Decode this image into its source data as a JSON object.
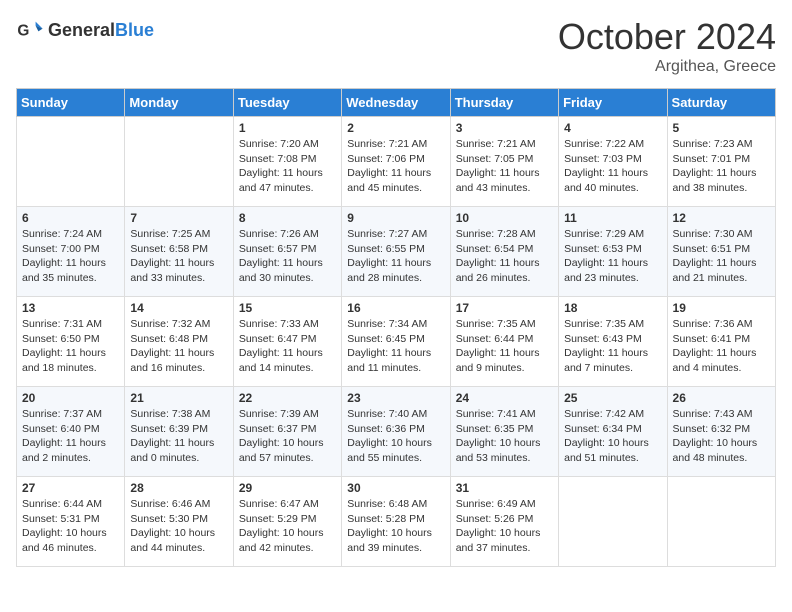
{
  "header": {
    "logo_general": "General",
    "logo_blue": "Blue",
    "month": "October 2024",
    "location": "Argithea, Greece"
  },
  "columns": [
    "Sunday",
    "Monday",
    "Tuesday",
    "Wednesday",
    "Thursday",
    "Friday",
    "Saturday"
  ],
  "weeks": [
    [
      {
        "day": "",
        "content": ""
      },
      {
        "day": "",
        "content": ""
      },
      {
        "day": "1",
        "content": "Sunrise: 7:20 AM\nSunset: 7:08 PM\nDaylight: 11 hours and 47 minutes."
      },
      {
        "day": "2",
        "content": "Sunrise: 7:21 AM\nSunset: 7:06 PM\nDaylight: 11 hours and 45 minutes."
      },
      {
        "day": "3",
        "content": "Sunrise: 7:21 AM\nSunset: 7:05 PM\nDaylight: 11 hours and 43 minutes."
      },
      {
        "day": "4",
        "content": "Sunrise: 7:22 AM\nSunset: 7:03 PM\nDaylight: 11 hours and 40 minutes."
      },
      {
        "day": "5",
        "content": "Sunrise: 7:23 AM\nSunset: 7:01 PM\nDaylight: 11 hours and 38 minutes."
      }
    ],
    [
      {
        "day": "6",
        "content": "Sunrise: 7:24 AM\nSunset: 7:00 PM\nDaylight: 11 hours and 35 minutes."
      },
      {
        "day": "7",
        "content": "Sunrise: 7:25 AM\nSunset: 6:58 PM\nDaylight: 11 hours and 33 minutes."
      },
      {
        "day": "8",
        "content": "Sunrise: 7:26 AM\nSunset: 6:57 PM\nDaylight: 11 hours and 30 minutes."
      },
      {
        "day": "9",
        "content": "Sunrise: 7:27 AM\nSunset: 6:55 PM\nDaylight: 11 hours and 28 minutes."
      },
      {
        "day": "10",
        "content": "Sunrise: 7:28 AM\nSunset: 6:54 PM\nDaylight: 11 hours and 26 minutes."
      },
      {
        "day": "11",
        "content": "Sunrise: 7:29 AM\nSunset: 6:53 PM\nDaylight: 11 hours and 23 minutes."
      },
      {
        "day": "12",
        "content": "Sunrise: 7:30 AM\nSunset: 6:51 PM\nDaylight: 11 hours and 21 minutes."
      }
    ],
    [
      {
        "day": "13",
        "content": "Sunrise: 7:31 AM\nSunset: 6:50 PM\nDaylight: 11 hours and 18 minutes."
      },
      {
        "day": "14",
        "content": "Sunrise: 7:32 AM\nSunset: 6:48 PM\nDaylight: 11 hours and 16 minutes."
      },
      {
        "day": "15",
        "content": "Sunrise: 7:33 AM\nSunset: 6:47 PM\nDaylight: 11 hours and 14 minutes."
      },
      {
        "day": "16",
        "content": "Sunrise: 7:34 AM\nSunset: 6:45 PM\nDaylight: 11 hours and 11 minutes."
      },
      {
        "day": "17",
        "content": "Sunrise: 7:35 AM\nSunset: 6:44 PM\nDaylight: 11 hours and 9 minutes."
      },
      {
        "day": "18",
        "content": "Sunrise: 7:35 AM\nSunset: 6:43 PM\nDaylight: 11 hours and 7 minutes."
      },
      {
        "day": "19",
        "content": "Sunrise: 7:36 AM\nSunset: 6:41 PM\nDaylight: 11 hours and 4 minutes."
      }
    ],
    [
      {
        "day": "20",
        "content": "Sunrise: 7:37 AM\nSunset: 6:40 PM\nDaylight: 11 hours and 2 minutes."
      },
      {
        "day": "21",
        "content": "Sunrise: 7:38 AM\nSunset: 6:39 PM\nDaylight: 11 hours and 0 minutes."
      },
      {
        "day": "22",
        "content": "Sunrise: 7:39 AM\nSunset: 6:37 PM\nDaylight: 10 hours and 57 minutes."
      },
      {
        "day": "23",
        "content": "Sunrise: 7:40 AM\nSunset: 6:36 PM\nDaylight: 10 hours and 55 minutes."
      },
      {
        "day": "24",
        "content": "Sunrise: 7:41 AM\nSunset: 6:35 PM\nDaylight: 10 hours and 53 minutes."
      },
      {
        "day": "25",
        "content": "Sunrise: 7:42 AM\nSunset: 6:34 PM\nDaylight: 10 hours and 51 minutes."
      },
      {
        "day": "26",
        "content": "Sunrise: 7:43 AM\nSunset: 6:32 PM\nDaylight: 10 hours and 48 minutes."
      }
    ],
    [
      {
        "day": "27",
        "content": "Sunrise: 6:44 AM\nSunset: 5:31 PM\nDaylight: 10 hours and 46 minutes."
      },
      {
        "day": "28",
        "content": "Sunrise: 6:46 AM\nSunset: 5:30 PM\nDaylight: 10 hours and 44 minutes."
      },
      {
        "day": "29",
        "content": "Sunrise: 6:47 AM\nSunset: 5:29 PM\nDaylight: 10 hours and 42 minutes."
      },
      {
        "day": "30",
        "content": "Sunrise: 6:48 AM\nSunset: 5:28 PM\nDaylight: 10 hours and 39 minutes."
      },
      {
        "day": "31",
        "content": "Sunrise: 6:49 AM\nSunset: 5:26 PM\nDaylight: 10 hours and 37 minutes."
      },
      {
        "day": "",
        "content": ""
      },
      {
        "day": "",
        "content": ""
      }
    ]
  ]
}
